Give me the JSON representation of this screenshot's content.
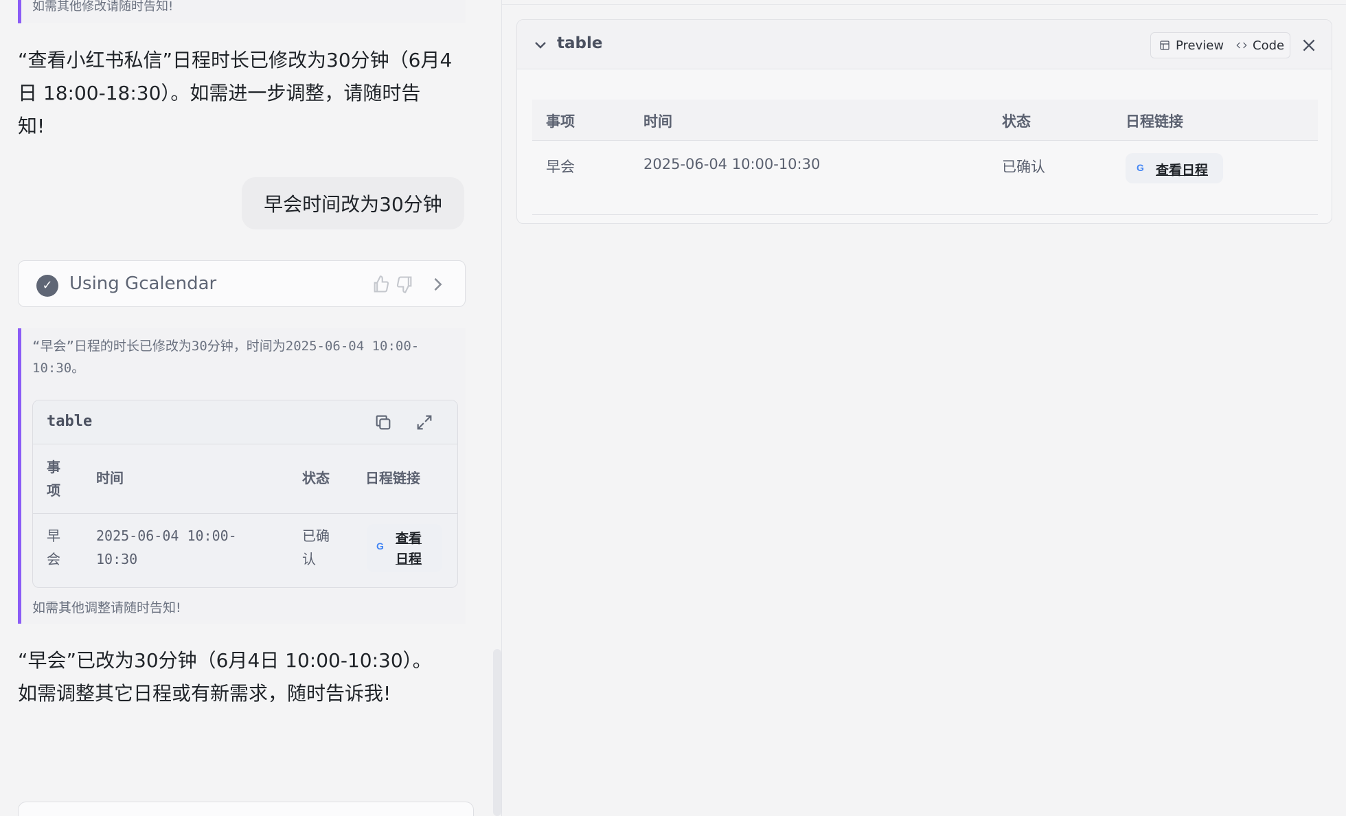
{
  "chat": {
    "top_quote_text": "如需其他修改请随时告知!",
    "assistant_msg_1_line1": "“查看小红书私信”日程时长已修改为30分钟（6月4",
    "assistant_msg_1_line2": "日 18:00-18:30）。如需进一步调整，请随时告",
    "assistant_msg_1_line3": "知!",
    "user_msg": "早会时间改为30分钟",
    "tool_call_label": "Using Gcalendar",
    "tool_quote_line1": "“早会”日程的时长已修改为30分钟，时间为2025-06-04 10:00-",
    "tool_quote_line2": "10:30。",
    "tool_quote_footer": "如需其他调整请随时告知!",
    "assistant_msg_2_line1": "“早会”已改为30分钟（6月4日 10:00-10:30）。",
    "assistant_msg_2_line2": "如需调整其它日程或有新需求，随时告诉我!"
  },
  "inner_table": {
    "title": "table",
    "headers": [
      "事\n项",
      "时间",
      "状态",
      "日程链接"
    ],
    "header_item_l1": "事",
    "header_item_l2": "项",
    "header_time": "时间",
    "header_status": "状态",
    "header_link": "日程链接",
    "row": {
      "item_l1": "早",
      "item_l2": "会",
      "time_l1": "2025-06-04 10:00-",
      "time_l2": "10:30",
      "status_l1": "已确",
      "status_l2": "认",
      "link_l1": "查看",
      "link_l2": "日程",
      "link_icon_letter": "G"
    }
  },
  "panel": {
    "title": "table",
    "preview_label": "Preview",
    "code_label": "Code",
    "headers": {
      "item": "事项",
      "time": "时间",
      "status": "状态",
      "link": "日程链接"
    },
    "rows": [
      {
        "item": "早会",
        "time": "2025-06-04 10:00-10:30",
        "status": "已确认",
        "link": "查看日程",
        "link_icon_letter": "G"
      }
    ]
  },
  "icons": {
    "check": "check-circle-icon",
    "thumbs_up": "thumbs-up-icon",
    "thumbs_down": "thumbs-down-icon",
    "chevron_right": "chevron-right-icon",
    "copy": "copy-icon",
    "expand": "expand-icon",
    "chevron_down": "chevron-down-icon",
    "preview": "layout-icon",
    "code": "code-icon",
    "close": "close-icon"
  },
  "colors": {
    "accent": "#8b5cf6",
    "background": "#f4f4f5",
    "google_blue": "#4285f4"
  }
}
